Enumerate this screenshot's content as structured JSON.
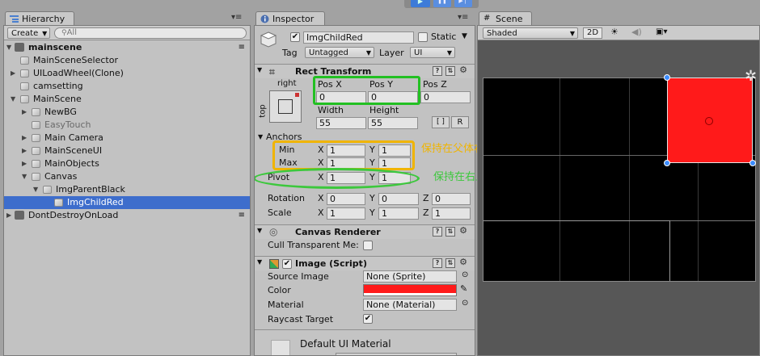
{
  "play_controls": {
    "play": "▶",
    "pause": "❚❚",
    "step": "▶❘"
  },
  "hierarchy": {
    "tab_title": "Hierarchy",
    "create_label": "Create",
    "search_placeholder": "All",
    "scene_name": "mainscene",
    "items": [
      {
        "label": "MainSceneSelector",
        "indent": 1,
        "fold": ""
      },
      {
        "label": "UILoadWheel(Clone)",
        "indent": 1,
        "fold": "▶"
      },
      {
        "label": "camsetting",
        "indent": 1,
        "fold": ""
      },
      {
        "label": "MainScene",
        "indent": 1,
        "fold": "▼"
      },
      {
        "label": "NewBG",
        "indent": 2,
        "fold": "▶"
      },
      {
        "label": "EasyTouch",
        "indent": 2,
        "fold": ""
      },
      {
        "label": "Main Camera",
        "indent": 2,
        "fold": "▶"
      },
      {
        "label": "MainSceneUI",
        "indent": 2,
        "fold": "▶"
      },
      {
        "label": "MainObjects",
        "indent": 2,
        "fold": "▶"
      },
      {
        "label": "Canvas",
        "indent": 2,
        "fold": "▼"
      },
      {
        "label": "ImgParentBlack",
        "indent": 3,
        "fold": "▼"
      },
      {
        "label": "ImgChildRed",
        "indent": 4,
        "fold": ""
      }
    ],
    "dont_destroy": "DontDestroyOnLoad"
  },
  "inspector": {
    "tab_title": "Inspector",
    "object_name": "ImgChildRed",
    "static_label": "Static",
    "tag_label": "Tag",
    "tag_value": "Untagged",
    "layer_label": "Layer",
    "layer_value": "UI",
    "rect_transform": {
      "title": "Rect Transform",
      "anchor_preset_h": "right",
      "anchor_preset_v": "top",
      "pos_x_label": "Pos X",
      "pos_x": "0",
      "pos_y_label": "Pos Y",
      "pos_y": "0",
      "pos_z_label": "Pos Z",
      "pos_z": "0",
      "width_label": "Width",
      "width": "55",
      "height_label": "Height",
      "height": "55",
      "r_button": "R",
      "anchors_label": "Anchors",
      "min_label": "Min",
      "min_x": "1",
      "min_y": "1",
      "max_label": "Max",
      "max_x": "1",
      "max_y": "1",
      "pivot_label": "Pivot",
      "pivot_x": "1",
      "pivot_y": "1",
      "rotation_label": "Rotation",
      "rot_x": "0",
      "rot_y": "0",
      "rot_z": "0",
      "scale_label": "Scale",
      "scale_x": "1",
      "scale_y": "1",
      "scale_z": "1",
      "x": "X",
      "y": "Y",
      "z": "Z"
    },
    "canvas_renderer": {
      "title": "Canvas Renderer",
      "cull_label": "Cull Transparent Me:"
    },
    "image": {
      "title": "Image (Script)",
      "source_label": "Source Image",
      "source_value": "None (Sprite)",
      "color_label": "Color",
      "color_value": "#ff1a1a",
      "material_label": "Material",
      "material_value": "None (Material)",
      "raycast_label": "Raycast Target"
    },
    "default_material": "Default UI Material"
  },
  "annotations": {
    "anchors_note": "保持在父体右上角",
    "pivot_note": "保持在右上角",
    "pos_color": "#22c022",
    "anchors_color": "#f0b400",
    "pivot_color": "#3cc83c"
  },
  "scene": {
    "tab_title": "Scene",
    "shaded_label": "Shaded",
    "mode_2d": "2D"
  }
}
